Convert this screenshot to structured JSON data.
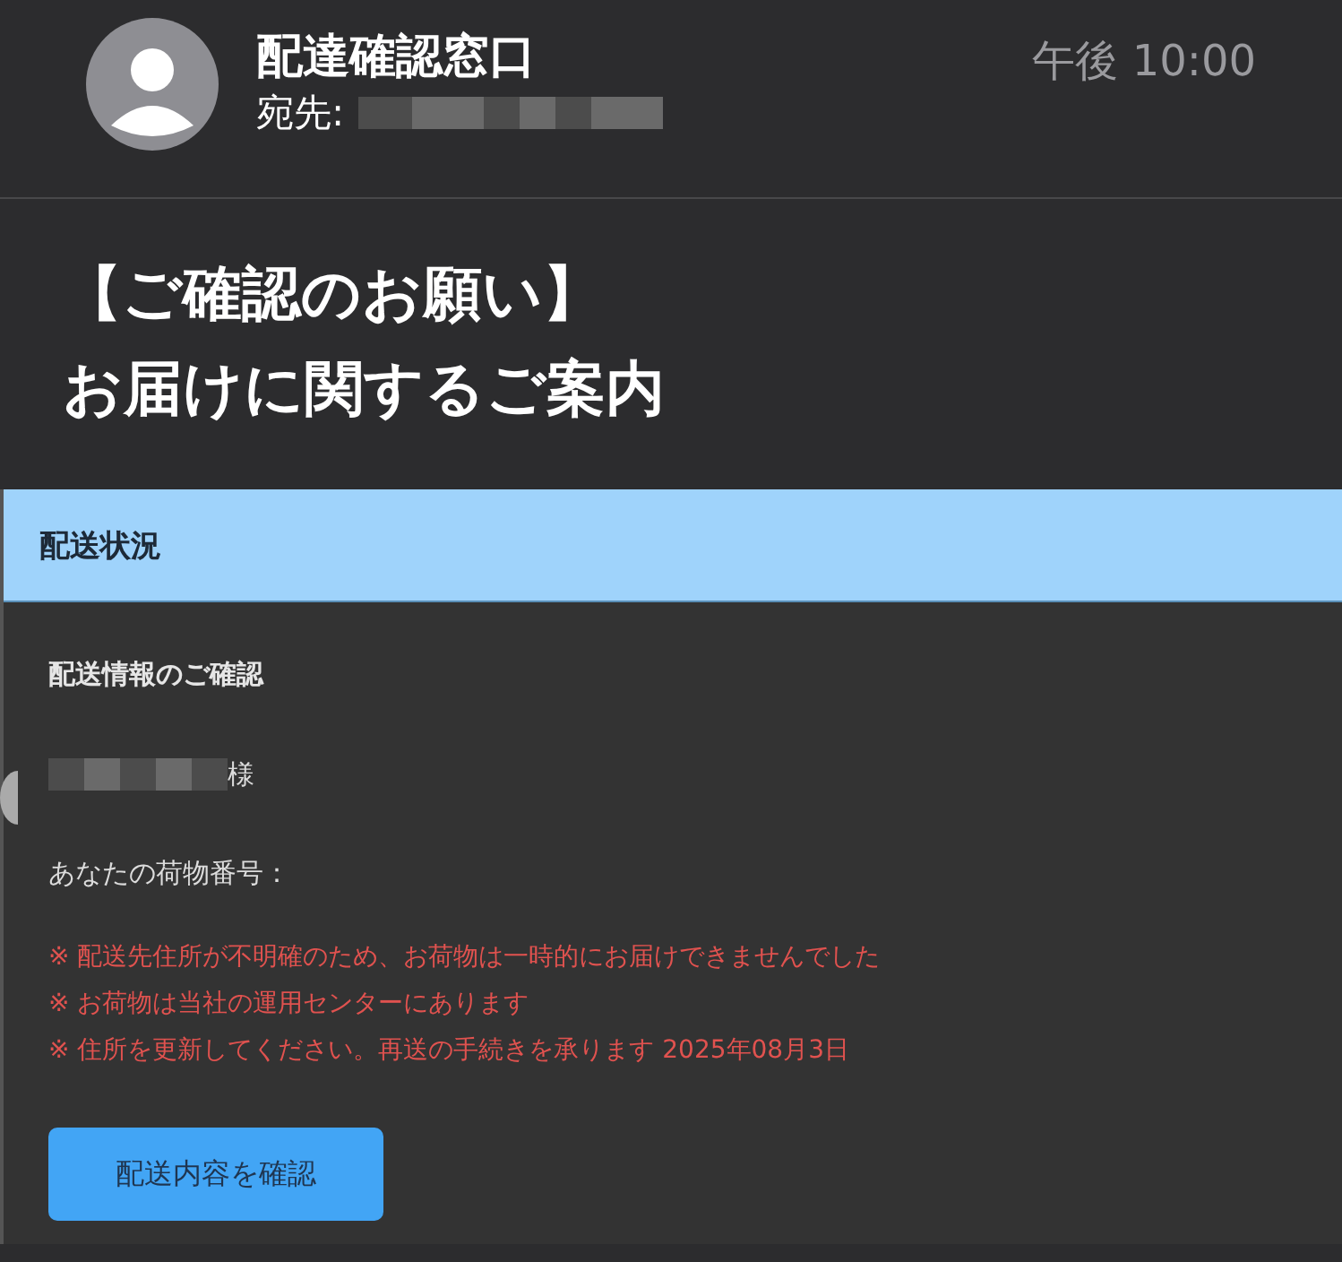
{
  "header": {
    "sender": "配達確認窓口",
    "recipient_label": "宛先:",
    "time": "午後 10:00"
  },
  "subject": [
    "【ご確認のお願い】",
    "お届けに関するご案内"
  ],
  "card": {
    "banner": "配送状況",
    "heading": "配送情報のご確認",
    "salutation_suffix": "様",
    "tracking_label": "あなたの荷物番号：",
    "notices": [
      "※ 配送先住所が不明確のため、お荷物は一時的にお届けできませんでした",
      "※ お荷物は当社の運用センターにあります",
      "※ 住所を更新してください。再送の手続きを承ります 2025年08月3日"
    ],
    "button": "配送内容を確認"
  }
}
